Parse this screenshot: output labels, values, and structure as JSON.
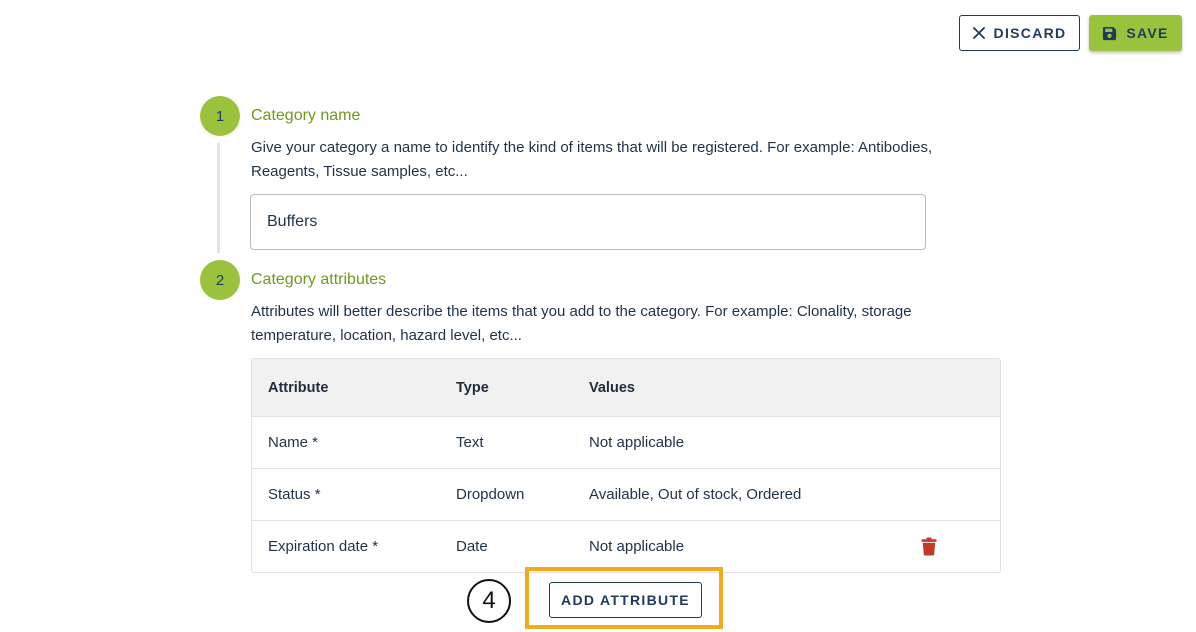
{
  "toolbar": {
    "discard_label": "DISCARD",
    "save_label": "SAVE"
  },
  "steps": [
    {
      "number": "1",
      "title": "Category name",
      "description": "Give your category a name to identify the kind of items that will be registered. For example: Antibodies, Reagents, Tissue samples, etc..."
    },
    {
      "number": "2",
      "title": "Category attributes",
      "description": "Attributes will better describe the items that you add to the category. For example: Clonality, storage temperature, location, hazard level, etc..."
    }
  ],
  "category_name": {
    "value": "Buffers"
  },
  "table": {
    "headers": [
      "Attribute",
      "Type",
      "Values"
    ],
    "rows": [
      {
        "attribute": "Name *",
        "type": "Text",
        "values": "Not applicable",
        "deletable": false
      },
      {
        "attribute": "Status *",
        "type": "Dropdown",
        "values": "Available, Out of stock, Ordered",
        "deletable": false
      },
      {
        "attribute": "Expiration date *",
        "type": "Date",
        "values": "Not applicable",
        "deletable": true
      }
    ]
  },
  "add_attribute_label": "ADD ATTRIBUTE",
  "callout_number": "4",
  "colors": {
    "accent": "#9bc23c",
    "step_title": "#6e9a1c",
    "navy": "#1f3a5a",
    "highlight": "#f2a91b",
    "delete": "#c0392b"
  },
  "icons": {
    "discard": "close-icon",
    "save": "save-icon",
    "delete": "trash-icon"
  }
}
